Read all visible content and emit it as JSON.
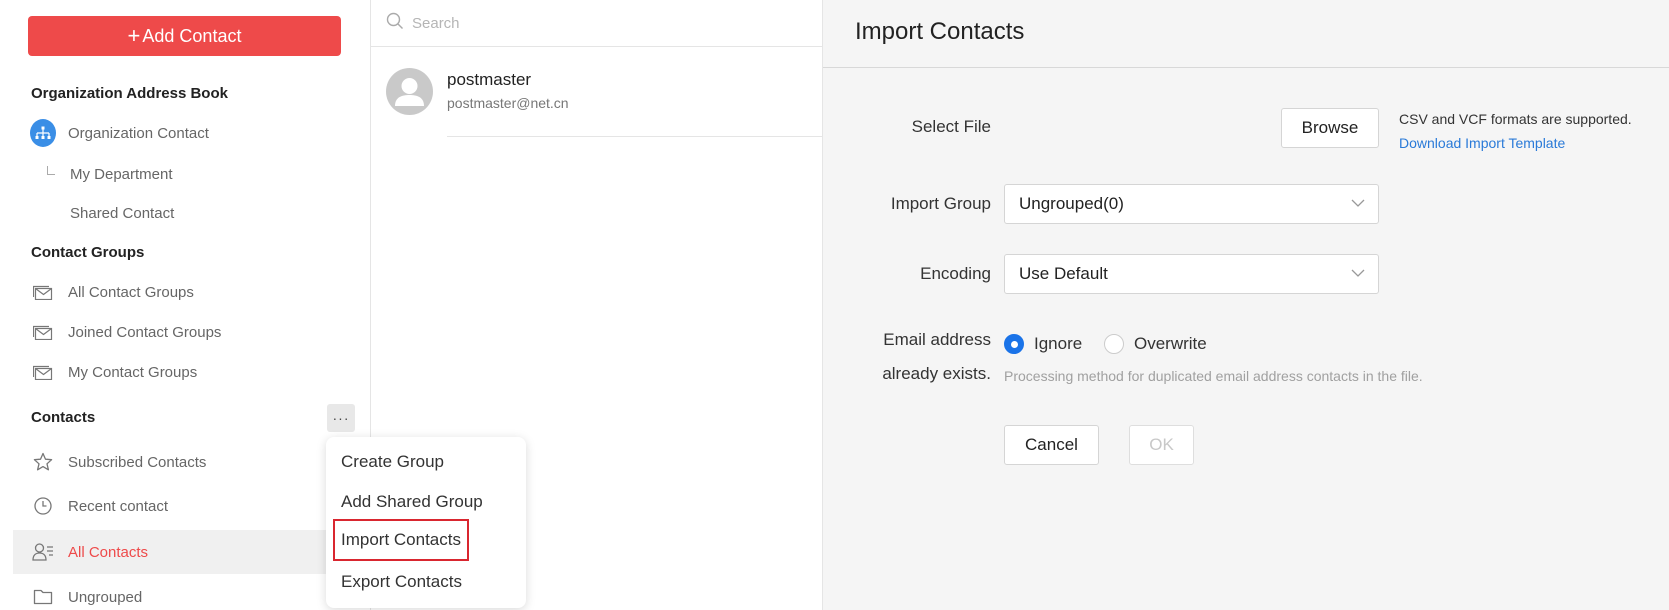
{
  "sidebar": {
    "add_contact": "Add Contact",
    "org_title": "Organization Address Book",
    "org_contact": "Organization Contact",
    "my_department": "My Department",
    "shared_contact": "Shared Contact",
    "groups_title": "Contact Groups",
    "all_groups": "All Contact Groups",
    "joined_groups": "Joined Contact Groups",
    "my_groups": "My Contact Groups",
    "contacts_title": "Contacts",
    "more": "···",
    "subscribed": "Subscribed Contacts",
    "recent": "Recent contact",
    "all_contacts": "All Contacts",
    "ungrouped": "Ungrouped"
  },
  "list": {
    "search_placeholder": "Search",
    "contact_name": "postmaster",
    "contact_email": "postmaster@net.cn"
  },
  "menu": {
    "items": [
      "Create Group",
      "Add Shared Group",
      "Import Contacts",
      "Export Contacts"
    ]
  },
  "import": {
    "title": "Import Contacts",
    "select_file_label": "Select File",
    "browse": "Browse",
    "formats_hint": "CSV and VCF formats are supported.",
    "download_template": "Download Import Template",
    "group_label": "Import Group",
    "group_value": "Ungrouped(0)",
    "encoding_label": "Encoding",
    "encoding_value": "Use Default",
    "exists_label_1": "Email address",
    "exists_label_2": "already exists.",
    "opt_ignore": "Ignore",
    "opt_overwrite": "Overwrite",
    "exists_hint": "Processing method for duplicated email address contacts in the file.",
    "cancel": "Cancel",
    "ok": "OK"
  },
  "colors": {
    "accent": "#ee4a4a",
    "link": "#2a7ad8",
    "radio": "#1a73e8"
  }
}
